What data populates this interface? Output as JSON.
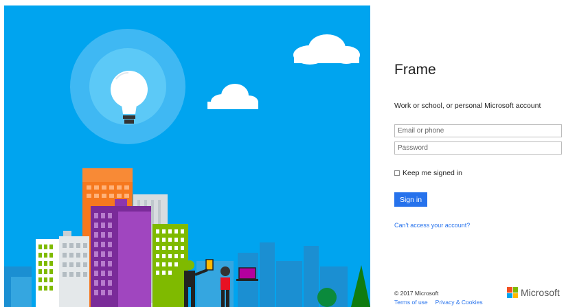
{
  "app": {
    "title": "Frame",
    "subtitle": "Work or school, or personal Microsoft account"
  },
  "form": {
    "email_placeholder": "Email or phone",
    "password_placeholder": "Password",
    "keep_signed_in_label": "Keep me signed in",
    "keep_signed_in_checked": false,
    "signin_label": "Sign in",
    "cant_access_label": "Can't access your account?"
  },
  "footer": {
    "copyright": "© 2017 Microsoft",
    "terms_label": "Terms of use",
    "privacy_label": "Privacy & Cookies",
    "brand_label": "Microsoft"
  },
  "colors": {
    "sky": "#00a4ef",
    "accent": "#2672ec",
    "ms_red": "#f25022",
    "ms_green": "#7fba00",
    "ms_blue": "#00a4ef",
    "ms_yellow": "#ffb900"
  },
  "icons": {
    "hero_bulb": "lightbulb-icon",
    "logo": "microsoft-logo-icon"
  }
}
